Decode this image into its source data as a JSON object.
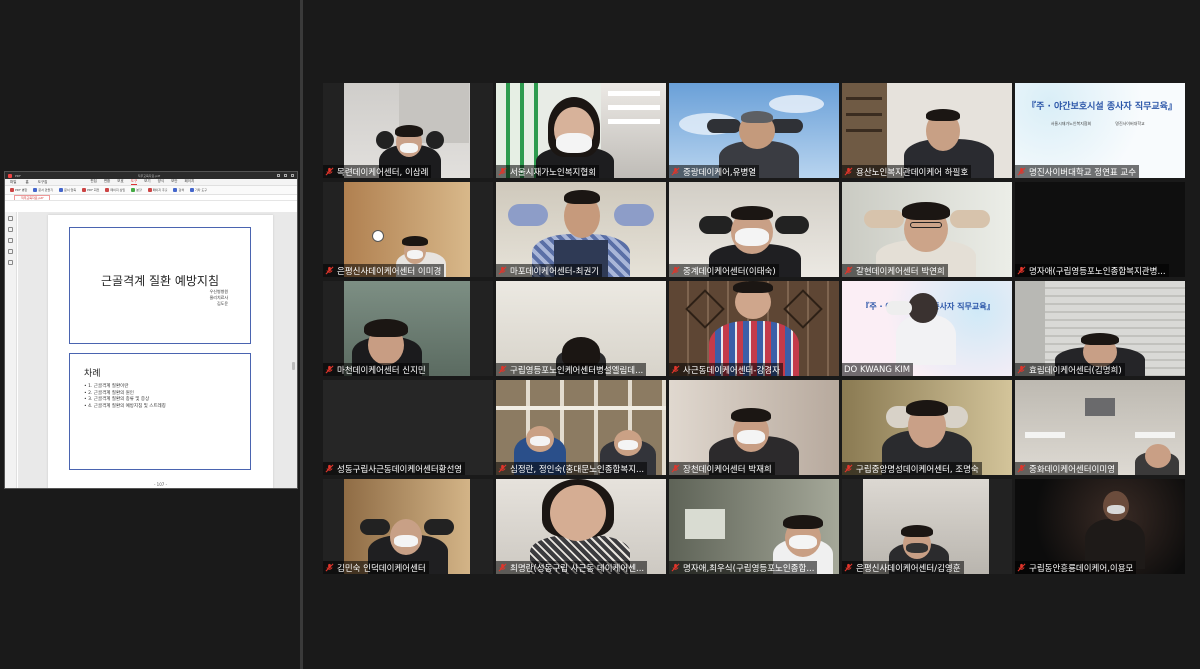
{
  "share": {
    "window_title": "직무교육자료.pdf",
    "titlebar_left": "PDF",
    "menu_left": [
      "파일",
      "홈",
      "도구집"
    ],
    "menu_right": [
      "편집",
      "변환",
      "보호",
      "도구",
      "보기",
      "양식",
      "보안",
      "페이지"
    ],
    "active_menu_index": 3,
    "toolbar": [
      "PDF 병합",
      "문서 만들기",
      "문서 압축",
      "PDF 회전",
      "페이지 삽입",
      "분할",
      "페이지 추출",
      "검색",
      "기타 도구"
    ],
    "tab_label": "직무교육자료.pdf",
    "page_label_top": "",
    "slide1": {
      "title": "근골격계 질환 예방지침",
      "author_lines": [
        "우신병병원",
        "물리치료사",
        "김도윤"
      ]
    },
    "slide2": {
      "title": "차례",
      "items": [
        "• 1. 근골격계 질환이란",
        "• 2. 근골격계 질환의 원인",
        "• 3. 근골격계 질환의 종류 및 증상",
        "• 4. 근골격계 질환의 예방지침 및 스트레칭"
      ]
    },
    "page_footer": "- 107 -"
  },
  "participants": [
    {
      "name": "목련데이케어센터, 이삼례",
      "muted": true
    },
    {
      "name": "서울시재가노인복지협회",
      "muted": true
    },
    {
      "name": "중랑데이케어,유병열",
      "muted": true
    },
    {
      "name": "용산노인복지관데이케어 하필호",
      "muted": true
    },
    {
      "name": "명진사이버대학교 정연표 교수",
      "muted": true
    },
    {
      "name": "은평신사데이케어센터 이미경",
      "muted": true
    },
    {
      "name": "마포데이케어센터-최권기",
      "muted": true
    },
    {
      "name": "중계데이케어센터(이태숙)",
      "muted": true
    },
    {
      "name": "갈현데이케어센터 박연희",
      "muted": true
    },
    {
      "name": "명자애(구립영등포노인종합복지관병...",
      "muted": true
    },
    {
      "name": "마천데이케어센터 신지민",
      "muted": true
    },
    {
      "name": "구립영등포노인케어센터병설엘림데...",
      "muted": true
    },
    {
      "name": "사근동데이케어센터-강경자",
      "muted": true
    },
    {
      "name": "DO KWANG KIM",
      "muted": false,
      "active": true
    },
    {
      "name": "효림데이케어센터(김명희)",
      "muted": true
    },
    {
      "name": "성동구립사근동데이케어센터황선영",
      "muted": true
    },
    {
      "name": "심정란, 정인숙(홍대문노인종합복지...",
      "muted": true
    },
    {
      "name": "장천데이케어센터 박재희",
      "muted": true
    },
    {
      "name": "구립중앙명성데이케어센터, 조명숙",
      "muted": true
    },
    {
      "name": "중화데이케어센터이미영",
      "muted": true
    },
    {
      "name": "김민숙 인덕데이케어센터",
      "muted": true
    },
    {
      "name": "최명란(성동구립 사근동 데이케어센...",
      "muted": true
    },
    {
      "name": "명자애,최우식(구립영등포노인종합...",
      "muted": true
    },
    {
      "name": "은평신사데이케어센터/김영훈",
      "muted": true
    },
    {
      "name": "구립동안흥룡데이케어,이용모",
      "muted": true
    }
  ],
  "slide_share": {
    "title": "『주 · 야간보호시설 종사자 직무교육』",
    "partner_left": "서울시재가노인복지협회",
    "partner_right": "명진사이버대학교"
  },
  "overlay_banner": "『주 · 야간보호시설 종사자 직무교육』",
  "colors": {
    "background": "#1a1a1a",
    "active_speaker": "#e6e04a",
    "muted_icon": "#e0352b",
    "slide_border": "#4a64b0"
  }
}
